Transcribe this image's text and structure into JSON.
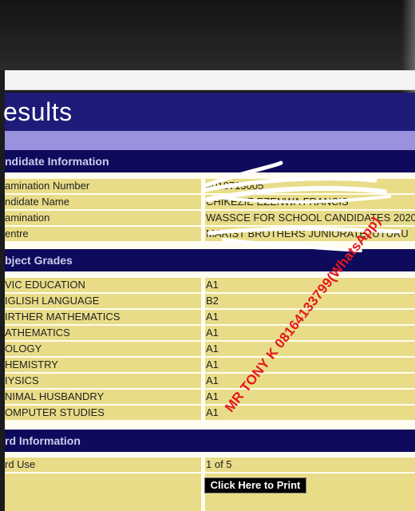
{
  "page": {
    "title": "esults"
  },
  "candidate": {
    "heading": "ndidate Information",
    "rows": [
      {
        "label": "amination Number",
        "value": "4010713005"
      },
      {
        "label": "ndidate Name",
        "value": "CHIKEZIE EZENWA FRANCIS"
      },
      {
        "label": "amination",
        "value": "WASSCE FOR SCHOOL CANDIDATES 2020"
      },
      {
        "label": "entre",
        "value": "MARIST BROTHERS JUNIORATE, UTURU"
      }
    ]
  },
  "grades": {
    "heading": "bject Grades",
    "rows": [
      {
        "label": "VIC EDUCATION",
        "value": "A1"
      },
      {
        "label": "IGLISH LANGUAGE",
        "value": "B2"
      },
      {
        "label": "IRTHER MATHEMATICS",
        "value": "A1"
      },
      {
        "label": "ATHEMATICS",
        "value": "A1"
      },
      {
        "label": "OLOGY",
        "value": "A1"
      },
      {
        "label": "HEMISTRY",
        "value": "A1"
      },
      {
        "label": "IYSICS",
        "value": "A1"
      },
      {
        "label": "NIMAL HUSBANDRY",
        "value": "A1"
      },
      {
        "label": "OMPUTER STUDIES",
        "value": "A1"
      }
    ]
  },
  "card": {
    "heading": "rd Information",
    "rows": [
      {
        "label": "rd Use",
        "value": "1 of 5"
      }
    ],
    "print_label": "Click Here to Print"
  },
  "watermark": {
    "text": "MR TONY K 08164133799(WhatsApp)"
  },
  "colors": {
    "header_blue": "#1f1b78",
    "section_navy": "#0e0b5c",
    "row_yellow": "#e8dc88",
    "watermark_red": "#e5171f"
  }
}
